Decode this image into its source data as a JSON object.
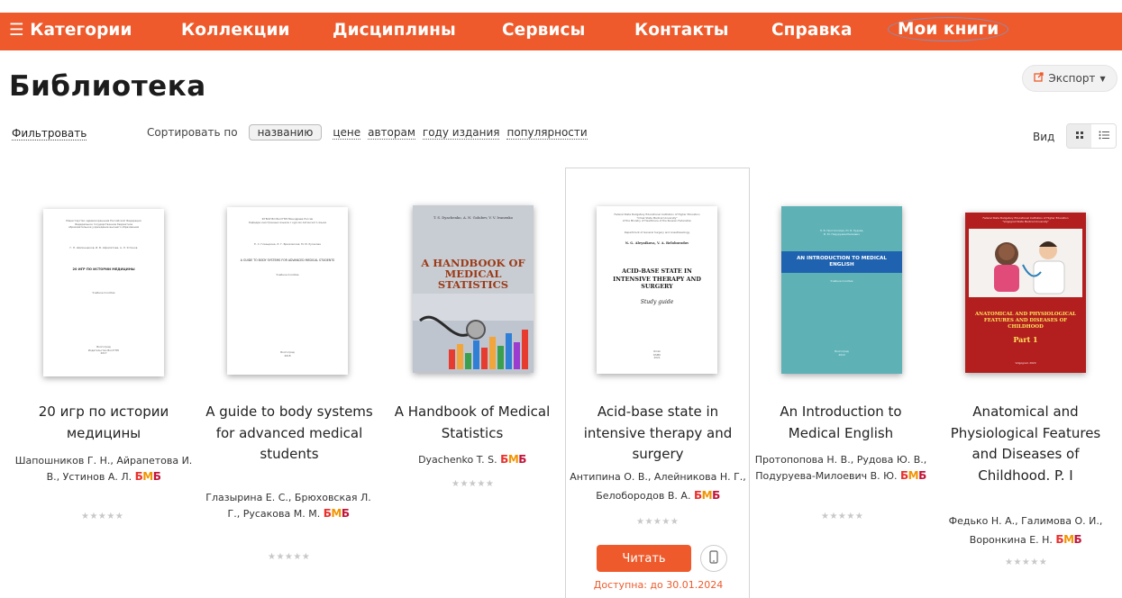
{
  "nav": {
    "menu_icon": "hamburger-icon",
    "items": [
      "Категории",
      "Коллекции",
      "Дисциплины",
      "Сервисы",
      "Контакты",
      "Справка",
      "Мои книги"
    ]
  },
  "page": {
    "title": "Библиотека",
    "export_label": "Экспорт",
    "export_icon": "external-link-icon"
  },
  "toolbar": {
    "filter_label": "Фильтровать",
    "sort_label": "Сортировать по",
    "sort_options": [
      "названию",
      "цене",
      "авторам",
      "году издания",
      "популярности"
    ],
    "sort_active": "названию",
    "view_label": "Вид",
    "view_icons": [
      "grid-icon",
      "list-icon"
    ]
  },
  "evs_logo": [
    "Б",
    "М",
    "Б"
  ],
  "rating_stars": "★★★★★",
  "books": [
    {
      "title": "20 игр по истории медицины",
      "authors": "Шапошников Г. Н., Айрапетова И. В., Устинов А. Л.",
      "cover": {
        "title": "20 ИГР ПО ИСТОРИИ МЕДИЦИНЫ",
        "note": "Учебное пособие",
        "bg": "#ffffff"
      }
    },
    {
      "title": "A guide to body systems for advanced medical students",
      "authors": "Глазырина Е. С., Брюховская Л. Г., Русакова М. М.",
      "cover": {
        "title": "A GUIDE TO BODY SYSTEMS FOR ADVANCED MEDICAL STUDENTS",
        "note": "Учебное пособие",
        "bg": "#ffffff"
      }
    },
    {
      "title": "A Handbook of Medical Statistics",
      "authors": "Dyachenko T. S.",
      "cover": {
        "authors": "T. S. Dyachenko, A. N. Golubev, V. V. Ivanenko",
        "title": "A HANDBOOK OF MEDICAL STATISTICS",
        "bg": "#c8ccd3"
      }
    },
    {
      "title": "Acid-base state in intensive therapy and surgery",
      "authors": "Антипина О. В., Алейникова Н. Г., Белобородов В. А.",
      "highlighted": true,
      "read_label": "Читать",
      "phone_icon": "smartphone-icon",
      "availability": "Доступна: до 30.01.2024",
      "cover": {
        "authors": "N. G. Aleynikova, V. A. Beloborodov",
        "title": "ACID-BASE STATE IN INTENSIVE THERAPY AND SURGERY",
        "subtitle": "Study guide",
        "bg": "#ffffff"
      }
    },
    {
      "title": "An Introduction to Medical English",
      "authors": "Протопопова Н. В., Рудова Ю. В., Подуруева-Милоевич В. Ю.",
      "cover": {
        "title": "AN INTRODUCTION TO MEDICAL ENGLISH",
        "bg": "#5eb2b6",
        "band": "#1f63b0"
      }
    },
    {
      "title": "Anatomical and Physiological Features and Diseases of Childhood. P. I",
      "authors": "Федько Н. А., Галимова О. И., Воронкина Е. Н.",
      "cover": {
        "title": "ANATOMICAL AND PHYSIOLOGICAL FEATURES AND DISEASES OF CHILDHOOD",
        "part": "Part 1",
        "bg": "#b31e1e"
      }
    }
  ]
}
